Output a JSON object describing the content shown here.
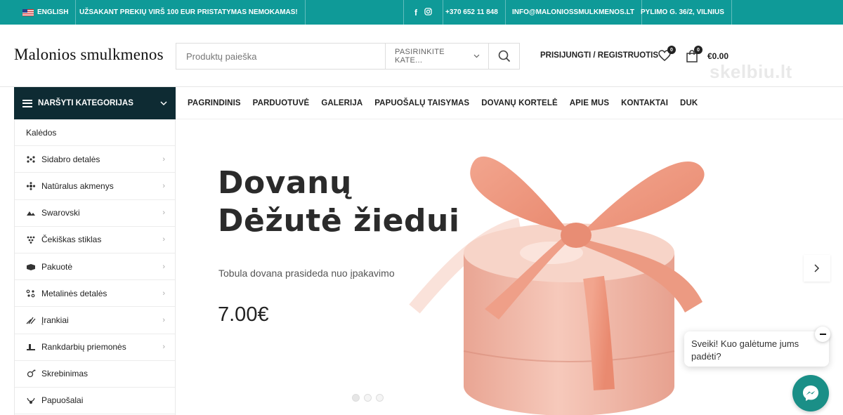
{
  "topbar": {
    "language": "ENGLISH",
    "promo": "UŽSAKANT PREKIŲ VIRŠ 100 EUR PRISTATYMAS NEMOKAMAS!",
    "phone": "+370 652 11 848",
    "email": "INFO@MALONIOSSMULKMENOS.LT",
    "address": "PYLIMO G. 36/2, VILNIUS",
    "background": "#0f9a98"
  },
  "header": {
    "logo": "Malonios smulkmenos",
    "search_placeholder": "Produktų paieška",
    "category_select": "PASIRINKITE KATE...",
    "login": "PRISIJUNGTI / REGISTRUOTIS",
    "wishlist_count": "0",
    "cart_count": "0",
    "cart_total": "€0.00",
    "watermark": "skelbiu.lt"
  },
  "categories_menu": {
    "label": "NARŠYTI KATEGORIJAS",
    "background": "#0e2b33",
    "items": [
      {
        "label": "Kalėdos",
        "icon": ""
      },
      {
        "label": "Sidabro detalės",
        "icon": "beads-icon"
      },
      {
        "label": "Natūralus akmenys",
        "icon": "stones-icon"
      },
      {
        "label": "Swarovski",
        "icon": "crystal-icon"
      },
      {
        "label": "Čekiškas stiklas",
        "icon": "glass-beads-icon"
      },
      {
        "label": "Pakuotė",
        "icon": "box-icon"
      },
      {
        "label": "Metalinės detalės",
        "icon": "metal-parts-icon"
      },
      {
        "label": "Įrankiai",
        "icon": "tools-icon"
      },
      {
        "label": "Rankdarbių priemonės",
        "icon": "craft-icon"
      },
      {
        "label": "Skrebinimas",
        "icon": "scrapbook-icon"
      },
      {
        "label": "Papuošalai",
        "icon": "jewelry-icon"
      }
    ]
  },
  "nav": {
    "items": [
      "PAGRINDINIS",
      "PARDUOTUVĖ",
      "GALERIJA",
      "PAPUOŠALŲ TAISYMAS",
      "DOVANŲ KORTELĖ",
      "APIE MUS",
      "KONTAKTAI",
      "DUK"
    ]
  },
  "hero": {
    "title_line1": "Dovanų",
    "title_line2": "Dėžutė žiedui",
    "subtitle": "Tobula dovana prasideda nuo įpakavimo",
    "price": "7.00€",
    "slides": 3,
    "active_slide": 1,
    "box_color": "#f0b9a8"
  },
  "chat": {
    "message": "Sveiki! Kuo galėtume jums padėti?",
    "button_color": "#1a8f87"
  }
}
